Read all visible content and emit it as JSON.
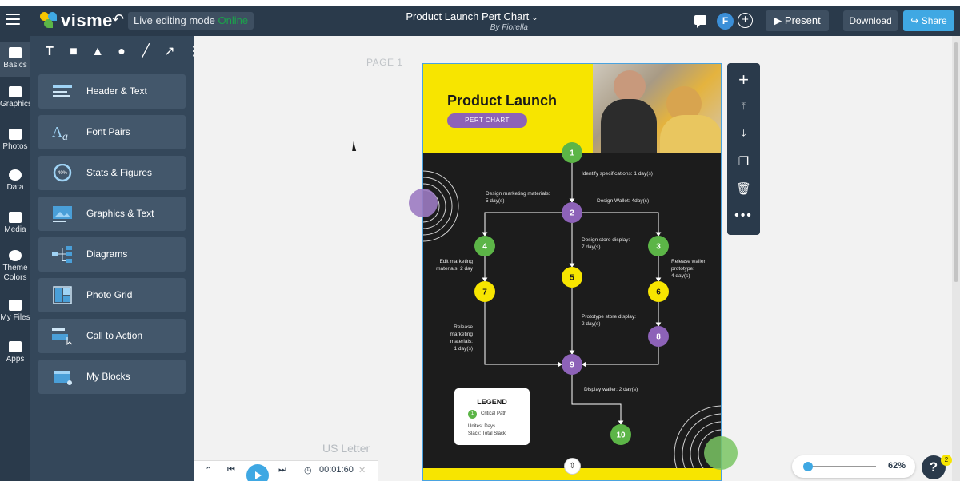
{
  "topbar": {
    "logo_text": "visme",
    "mode_label": "Live editing mode",
    "mode_status": "Online",
    "doc_title": "Product Launch Pert Chart",
    "doc_author": "By Fiorella",
    "avatar_initial": "F",
    "present_label": "Present",
    "download_label": "Download",
    "share_label": "Share"
  },
  "rail": {
    "items": [
      {
        "label": "Basics"
      },
      {
        "label": "Graphics"
      },
      {
        "label": "Photos"
      },
      {
        "label": "Data"
      },
      {
        "label": "Media"
      },
      {
        "label": "Theme Colors"
      },
      {
        "label": "My Files"
      },
      {
        "label": "Apps"
      }
    ]
  },
  "panel": {
    "cards": [
      {
        "label": "Header & Text"
      },
      {
        "label": "Font Pairs"
      },
      {
        "label": "Stats & Figures",
        "badge": "40%"
      },
      {
        "label": "Graphics & Text"
      },
      {
        "label": "Diagrams"
      },
      {
        "label": "Photo Grid"
      },
      {
        "label": "Call to Action"
      },
      {
        "label": "My Blocks"
      }
    ]
  },
  "canvas": {
    "page_label": "PAGE 1",
    "size_label": "US Letter"
  },
  "design": {
    "title": "Product Launch",
    "subtitle": "PERT CHART",
    "legend": {
      "title": "LEGEND",
      "critical_label": "Critical Path",
      "critical_num": "1",
      "units_line1": "Unites: Days",
      "units_line2": "Slack: Total Slack"
    },
    "nodes": [
      {
        "id": "1",
        "color": "#5cb547"
      },
      {
        "id": "2",
        "color": "#8d62b8"
      },
      {
        "id": "3",
        "color": "#5cb547"
      },
      {
        "id": "4",
        "color": "#5cb547"
      },
      {
        "id": "5",
        "color": "#f7e500"
      },
      {
        "id": "6",
        "color": "#f7e500"
      },
      {
        "id": "7",
        "color": "#f7e500"
      },
      {
        "id": "8",
        "color": "#8d62b8"
      },
      {
        "id": "9",
        "color": "#8d62b8"
      },
      {
        "id": "10",
        "color": "#5cb547"
      }
    ],
    "labels": [
      {
        "lines": [
          "Identify specifications: 1 day(s)"
        ]
      },
      {
        "lines": [
          "Design marketing materials:",
          "5 day(s)"
        ]
      },
      {
        "lines": [
          "Design Wallet: 4day(s)"
        ]
      },
      {
        "lines": [
          "Design store display:",
          "7 day(s)"
        ]
      },
      {
        "lines": [
          "Edit marketing",
          "materials: 2 day"
        ]
      },
      {
        "lines": [
          "Release waller",
          "prototype:",
          "4 day(s)"
        ]
      },
      {
        "lines": [
          "Prototype store display:",
          "2 day(s)"
        ]
      },
      {
        "lines": [
          "Release",
          "marketing",
          "materials:",
          "1 day(s)"
        ]
      },
      {
        "lines": [
          "Display waller: 2 day(s)"
        ]
      }
    ]
  },
  "player": {
    "time": "00:01:60"
  },
  "zoom": {
    "value": "62%",
    "level": 0.05
  },
  "help": {
    "label": "?",
    "badge": "2"
  },
  "colors": {
    "brand_dark": "#2a3a4b",
    "accent_blue": "#3fa8e3",
    "online_green": "#1ba24b",
    "yellow": "#f7e500",
    "purple": "#8d62b8",
    "green": "#5cb547"
  }
}
